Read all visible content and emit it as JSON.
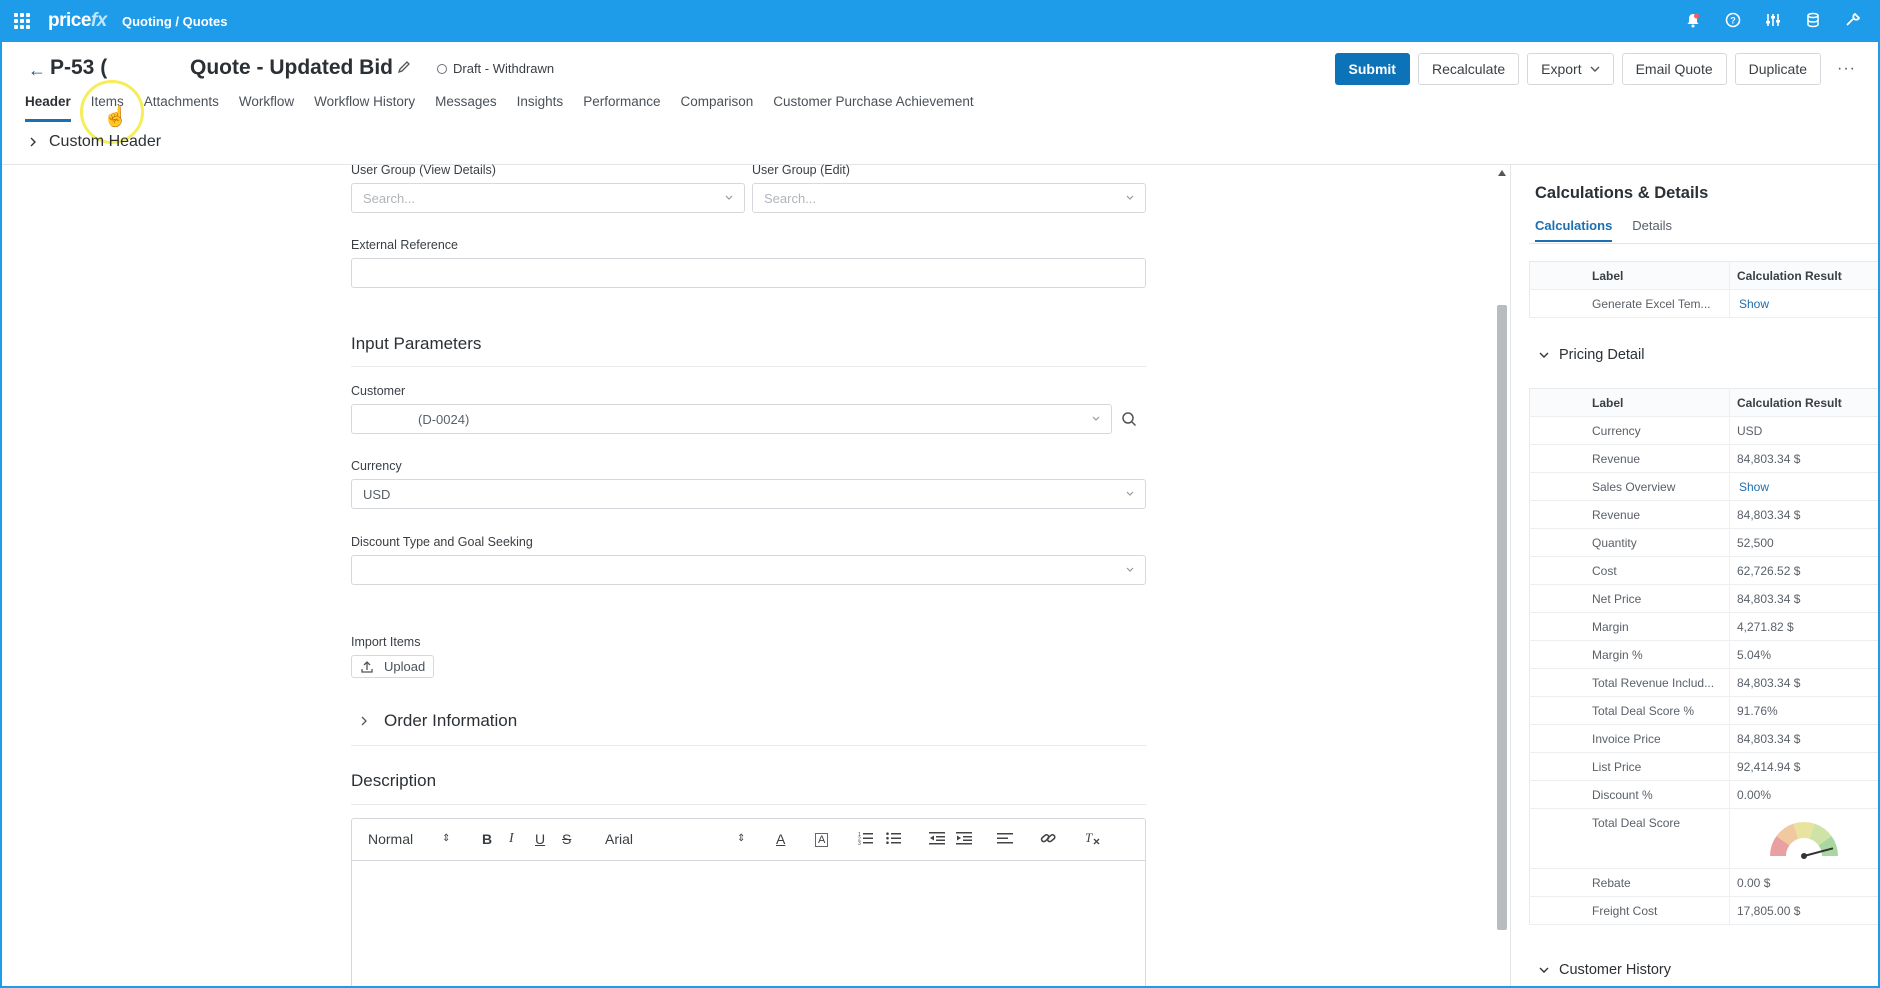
{
  "topbar": {
    "logo_main": "price",
    "logo_accent": "fx",
    "breadcrumb": "Quoting / Quotes",
    "icons": [
      "bell-icon",
      "help-icon",
      "sliders-icon",
      "database-icon",
      "tools-icon"
    ]
  },
  "quote": {
    "id": "P-53 (",
    "name": "Quote - Updated Bid",
    "status": "Draft - Withdrawn"
  },
  "actions": {
    "submit": "Submit",
    "recalculate": "Recalculate",
    "export": "Export",
    "email": "Email Quote",
    "duplicate": "Duplicate",
    "more": "···"
  },
  "tabs": [
    "Header",
    "Items",
    "Attachments",
    "Workflow",
    "Workflow History",
    "Messages",
    "Insights",
    "Performance",
    "Comparison",
    "Customer Purchase Achievement"
  ],
  "custom_header": "Custom Header",
  "form": {
    "user_group_view_label": "User Group (View Details)",
    "user_group_view_placeholder": "Search...",
    "user_group_edit_label": "User Group (Edit)",
    "user_group_edit_placeholder": "Search...",
    "external_ref_label": "External Reference",
    "external_ref_value": "",
    "input_params_title": "Input Parameters",
    "customer_label": "Customer",
    "customer_value": "(D-0024)",
    "currency_label": "Currency",
    "currency_value": "USD",
    "discount_label": "Discount Type and Goal Seeking",
    "discount_value": "",
    "import_label": "Import Items",
    "upload_label": "Upload",
    "order_info_title": "Order Information",
    "description_title": "Description"
  },
  "editor": {
    "format": "Normal",
    "font": "Arial"
  },
  "right_panel": {
    "title": "Calculations & Details",
    "tabs": [
      "Calculations",
      "Details"
    ],
    "col_label": "Label",
    "col_result": "Calculation Result",
    "calc_rows": [
      {
        "label": "Generate Excel Tem...",
        "value": "Show",
        "link": true
      }
    ],
    "pricing_detail_title": "Pricing Detail",
    "pricing_rows": [
      {
        "label": "Currency",
        "value": "USD"
      },
      {
        "label": "Revenue",
        "value": "84,803.34 $"
      },
      {
        "label": "Sales Overview",
        "value": "Show",
        "link": true
      },
      {
        "label": "Revenue",
        "value": "84,803.34 $"
      },
      {
        "label": "Quantity",
        "value": "52,500"
      },
      {
        "label": "Cost",
        "value": "62,726.52 $"
      },
      {
        "label": "Net Price",
        "value": "84,803.34 $"
      },
      {
        "label": "Margin",
        "value": "4,271.82 $"
      },
      {
        "label": "Margin %",
        "value": "5.04%"
      },
      {
        "label": "Total Revenue Includ...",
        "value": "84,803.34 $"
      },
      {
        "label": "Total Deal Score %",
        "value": "91.76%"
      },
      {
        "label": "Invoice Price",
        "value": "84,803.34 $"
      },
      {
        "label": "List Price",
        "value": "92,414.94 $"
      },
      {
        "label": "Discount %",
        "value": "0.00%"
      }
    ],
    "deal_score_label": "Total Deal Score",
    "deal_score_fraction": 0.9176,
    "tail_rows": [
      {
        "label": "Rebate",
        "value": "0.00 $"
      },
      {
        "label": "Freight Cost",
        "value": "17,805.00 $"
      }
    ],
    "customer_history_title": "Customer History"
  }
}
